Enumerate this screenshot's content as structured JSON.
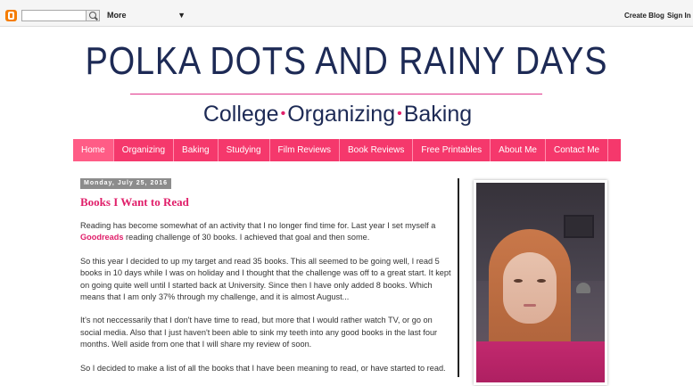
{
  "navbar": {
    "more_label": "More",
    "create_blog": "Create Blog",
    "sign_in": "Sign In"
  },
  "header": {
    "title": "POLKA DOTS AND RAINY DAYS",
    "tagline_1": "College",
    "tagline_2": "Organizing",
    "tagline_3": "Baking",
    "dot": "•"
  },
  "menu": {
    "items": [
      "Home",
      "Organizing",
      "Baking",
      "Studying",
      "Film Reviews",
      "Book Reviews",
      "Free Printables",
      "About Me",
      "Contact Me"
    ]
  },
  "post": {
    "date": "Monday, July 25, 2016",
    "title": "Books I Want to Read",
    "p1_a": "Reading has become somewhat of an activity that I no longer find time for. Last year I set myself a ",
    "p1_link": "Goodreads",
    "p1_b": " reading challenge of 30 books. I achieved that goal and then some.",
    "p2": "So this year I decided to up my target and read 35 books. This all seemed to be going well, I read 5 books in 10 days while I was on holiday and I thought that the challenge was off to a great start. It kept on going quite well until I started back at University. Since then I have only added 8 books. Which means that I am only 37% through my challenge, and it is almost August...",
    "p3": "It's not neccessarily that I don't have time to read, but more that I would rather watch TV, or go on social media. Also that I just haven't been able to sink my teeth into any good books in the last four months. Well aside from one that I will share my review of soon.",
    "p4": "So I decided to make a list of all the books that I have been meaning to read, or have started to read."
  },
  "colors": {
    "accent": "#e01f6a",
    "menu_bg": "#f5386c",
    "title_navy": "#1d2a55"
  }
}
